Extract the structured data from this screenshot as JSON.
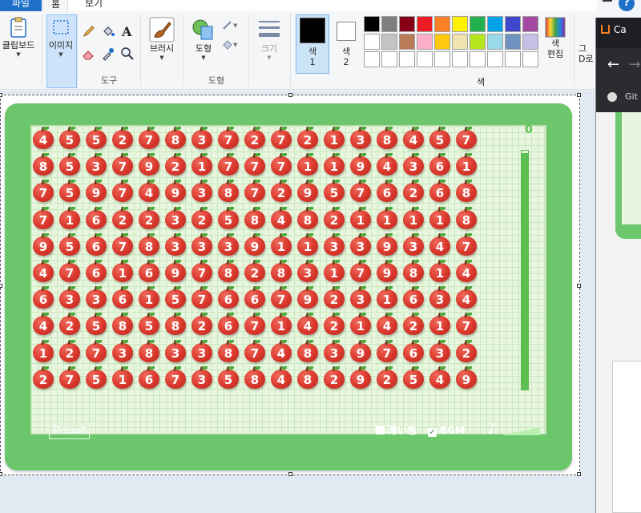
{
  "ribbon": {
    "tabs": [
      {
        "label": "파일"
      },
      {
        "label": "홈"
      },
      {
        "label": "보기"
      }
    ],
    "groups": {
      "clipboard": {
        "label": "클립보드"
      },
      "image": {
        "label": "이미지"
      },
      "tools": {
        "label": "도구"
      },
      "brushes": {
        "label": "브러시"
      },
      "shapes": {
        "label": "도형",
        "group_label": "도형"
      },
      "size": {
        "label": "크기"
      },
      "color1": {
        "label": "색\n1",
        "line1": "색",
        "line2": "1"
      },
      "color2": {
        "line1": "색",
        "line2": "2"
      },
      "colors_label": "색",
      "edit_colors": {
        "line1": "색",
        "line2": "편집"
      },
      "paint3d": {
        "line1": "그",
        "line2": "D로"
      }
    },
    "help": "?",
    "palette_row1": [
      "#000000",
      "#7f7f7f",
      "#880015",
      "#ed1c24",
      "#ff7f27",
      "#fff200",
      "#22b14c",
      "#00a2e8",
      "#3f48cc",
      "#a349a4"
    ],
    "palette_row2": [
      "#ffffff",
      "#c3c3c3",
      "#b97a57",
      "#ffaec9",
      "#ffc90e",
      "#efe4b0",
      "#b5e61d",
      "#99d9ea",
      "#7092be",
      "#c8bfe7"
    ],
    "palette_row3": [
      "#ffffff",
      "#ffffff",
      "#ffffff",
      "#ffffff",
      "#ffffff",
      "#ffffff",
      "#ffffff",
      "#ffffff",
      "#ffffff",
      "#ffffff"
    ],
    "primary_color": "#000000",
    "secondary_color": "#ffffff"
  },
  "game": {
    "score": "0",
    "time_remaining_fraction": 0.99,
    "reset_label": "Reset",
    "light_color_label": "薄い色",
    "light_color_checked": false,
    "bgm_label": "BGM",
    "bgm_checked": true,
    "grid": [
      [
        4,
        5,
        5,
        2,
        7,
        8,
        3,
        7,
        2,
        7,
        2,
        1,
        3,
        8,
        4,
        5,
        7
      ],
      [
        8,
        5,
        3,
        7,
        9,
        2,
        1,
        7,
        7,
        7,
        1,
        1,
        9,
        4,
        3,
        6,
        1
      ],
      [
        7,
        5,
        9,
        7,
        4,
        9,
        3,
        8,
        7,
        2,
        9,
        5,
        7,
        6,
        2,
        6,
        8
      ],
      [
        7,
        1,
        6,
        2,
        2,
        3,
        2,
        5,
        8,
        4,
        8,
        2,
        1,
        1,
        1,
        1,
        8
      ],
      [
        9,
        5,
        6,
        7,
        8,
        3,
        3,
        3,
        9,
        1,
        1,
        3,
        3,
        9,
        3,
        4,
        7
      ],
      [
        4,
        7,
        6,
        1,
        6,
        9,
        7,
        8,
        2,
        8,
        3,
        1,
        7,
        9,
        8,
        1,
        4
      ],
      [
        6,
        3,
        3,
        6,
        1,
        5,
        7,
        6,
        6,
        7,
        9,
        2,
        3,
        1,
        6,
        3,
        4
      ],
      [
        4,
        2,
        5,
        8,
        5,
        8,
        2,
        6,
        7,
        1,
        4,
        2,
        1,
        4,
        2,
        1,
        7
      ],
      [
        1,
        2,
        7,
        3,
        8,
        3,
        3,
        8,
        7,
        4,
        8,
        3,
        9,
        7,
        6,
        3,
        2
      ],
      [
        2,
        7,
        5,
        1,
        6,
        7,
        3,
        5,
        8,
        4,
        8,
        2,
        9,
        2,
        5,
        4,
        9
      ]
    ]
  },
  "browser": {
    "tab_title": "Ca",
    "bookmark": "Git"
  }
}
